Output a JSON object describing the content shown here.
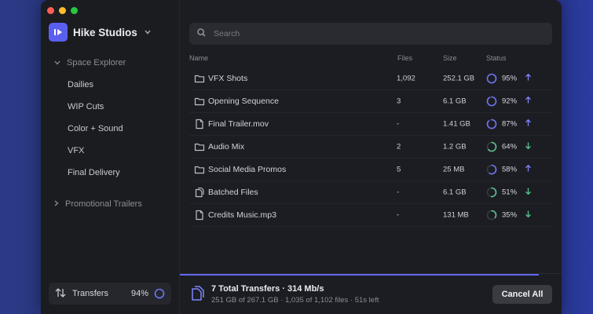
{
  "colors": {
    "accent": "#6167f0",
    "upload_arrow": "#7f86ff",
    "download_arrow": "#57c58e",
    "ring_upload": "#6f74f2",
    "ring_download": "#5cc28f"
  },
  "workspace": {
    "name": "Hike Studios",
    "icon": "play-logo-icon"
  },
  "sidebar": {
    "groups": [
      {
        "label": "Space Explorer",
        "expanded": true,
        "items": [
          "Dailies",
          "WIP Cuts",
          "Color + Sound",
          "VFX",
          "Final Delivery"
        ]
      },
      {
        "label": "Promotional Trailers",
        "expanded": false,
        "items": []
      }
    ],
    "transfers": {
      "label": "Transfers",
      "percent": "94%",
      "progress": 0.94
    }
  },
  "search": {
    "placeholder": "Search",
    "value": ""
  },
  "table": {
    "columns": [
      "Name",
      "Files",
      "Size",
      "Status"
    ],
    "rows": [
      {
        "type": "folder",
        "name": "VFX Shots",
        "files": "1,092",
        "size": "252.1 GB",
        "status": "95%",
        "progress": 0.95,
        "direction": "up"
      },
      {
        "type": "folder",
        "name": "Opening Sequence",
        "files": "3",
        "size": "6.1 GB",
        "status": "92%",
        "progress": 0.92,
        "direction": "up"
      },
      {
        "type": "file",
        "name": "Final Trailer.mov",
        "files": "-",
        "size": "1.41 GB",
        "status": "87%",
        "progress": 0.87,
        "direction": "up"
      },
      {
        "type": "folder",
        "name": "Audio Mix",
        "files": "2",
        "size": "1.2 GB",
        "status": "64%",
        "progress": 0.64,
        "direction": "down"
      },
      {
        "type": "folder",
        "name": "Social Media Promos",
        "files": "5",
        "size": "25 MB",
        "status": "58%",
        "progress": 0.58,
        "direction": "up"
      },
      {
        "type": "files",
        "name": "Batched Files",
        "files": "-",
        "size": "6.1 GB",
        "status": "51%",
        "progress": 0.51,
        "direction": "down"
      },
      {
        "type": "file",
        "name": "Credits Music.mp3",
        "files": "-",
        "size": "131 MB",
        "status": "35%",
        "progress": 0.35,
        "direction": "down"
      }
    ]
  },
  "footer": {
    "title": "7 Total Transfers  ·  314 Mb/s",
    "subtitle": "251 GB of 267.1 GB  ·  1,035 of 1,102 files  ·  51s left",
    "overall_progress": 0.94,
    "cancel_label": "Cancel All"
  }
}
